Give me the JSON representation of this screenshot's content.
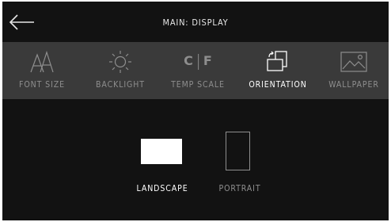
{
  "header": {
    "title": "MAIN: DISPLAY"
  },
  "tabs": [
    {
      "label": "FONT SIZE",
      "icon": "font-size-icon",
      "active": false
    },
    {
      "label": "BACKLIGHT",
      "icon": "sun-icon",
      "active": false
    },
    {
      "label": "TEMP SCALE",
      "icon": "c-f-icon",
      "active": false,
      "symbols": [
        "C",
        "F"
      ]
    },
    {
      "label": "ORIENTATION",
      "icon": "rotate-screen-icon",
      "active": true
    },
    {
      "label": "WALLPAPER",
      "icon": "image-icon",
      "active": false
    }
  ],
  "orientation": {
    "options": [
      {
        "label": "LANDSCAPE",
        "selected": true
      },
      {
        "label": "PORTRAIT",
        "selected": false
      }
    ]
  },
  "colors": {
    "background": "#121212",
    "tabbar": "#3a3a3a",
    "active": "#ffffff",
    "inactive": "#8e8e8e"
  }
}
